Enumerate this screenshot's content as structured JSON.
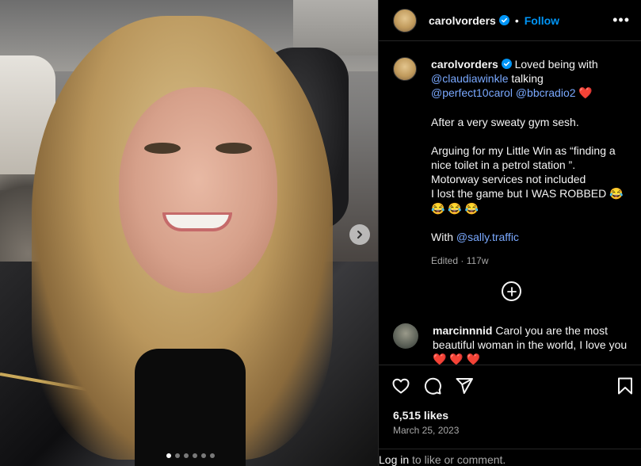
{
  "photo": {
    "alt_icon": "chevron-right-icon",
    "slide_count": 6,
    "active_slide": 0
  },
  "header": {
    "username": "carolvorders",
    "separator": "•",
    "follow_label": "Follow",
    "more_label": "•••"
  },
  "caption": {
    "username": "carolvorders",
    "intro": "Loved being with",
    "mention1": "@claudiawinkle",
    "talking": "talking",
    "mention2": "@perfect10carol",
    "mention3": "@bbcradio2",
    "heart": "❤️",
    "para1": "After a very sweaty gym sesh.",
    "para2_line1": "Arguing for my Little Win as “finding a nice toilet in a petrol station ”.",
    "para2_line2": "Motorway services not included",
    "para2_line3": "I lost the game but I WAS ROBBED 😂",
    "para2_line4": "😂 😂 😂",
    "with_label": "With",
    "mention4": "@sally.traffic",
    "meta": "Edited · 117w"
  },
  "comment": {
    "username": "marcinnnid",
    "text": "Carol you are the most beautiful woman in the world, I love you",
    "hearts": "❤️ ❤️ ❤️"
  },
  "footer": {
    "likes": "6,515 likes",
    "date": "March 25, 2023",
    "login_link": "Log in",
    "login_suffix": "to like or comment."
  },
  "colors": {
    "accent": "#0095f6",
    "background": "#000000",
    "text": "#f5f5f5",
    "muted": "#a8a8a8",
    "mention": "#7aa9ff"
  }
}
